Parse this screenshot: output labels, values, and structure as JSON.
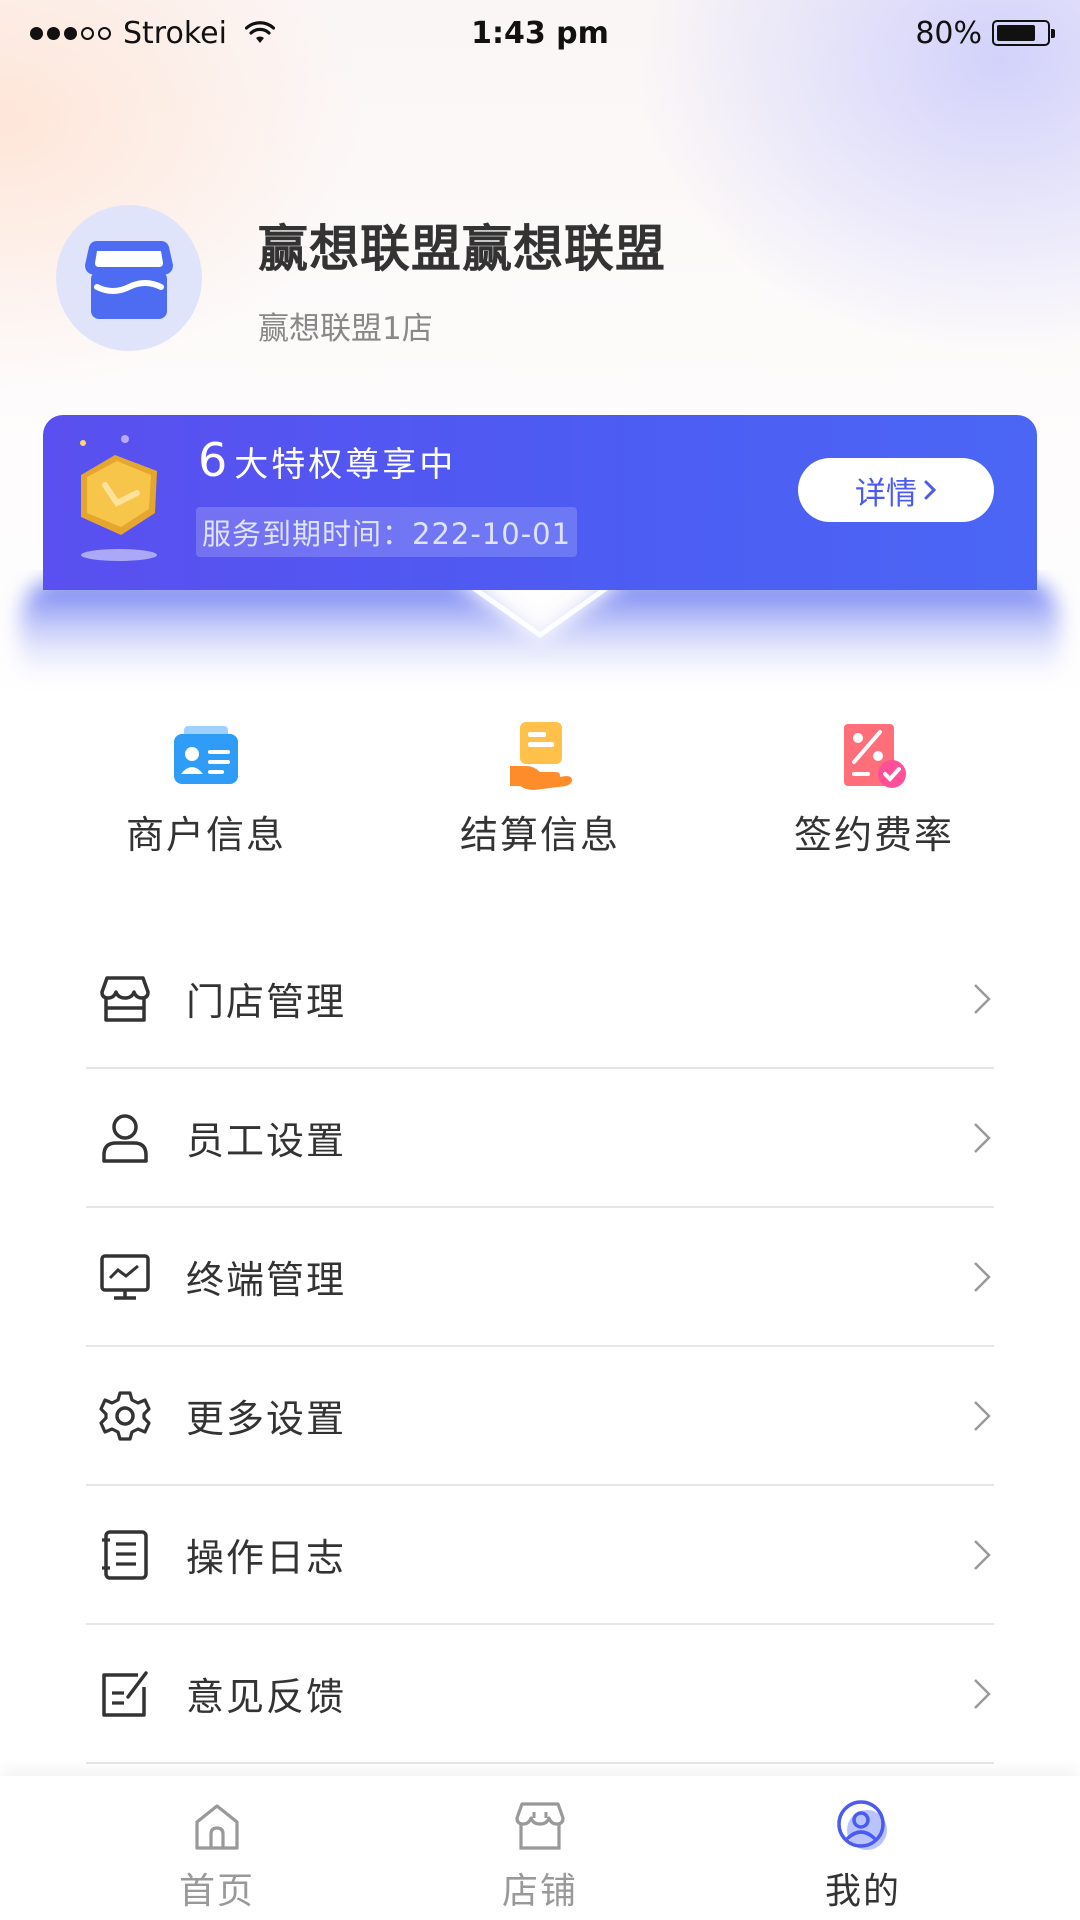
{
  "status_bar": {
    "carrier": "Strokei",
    "time": "1:43 pm",
    "battery": "80%",
    "battery_level": 0.8
  },
  "profile": {
    "store_name": "赢想联盟赢想联盟",
    "branch": "赢想联盟1店"
  },
  "vip": {
    "count": "6",
    "title": "大特权尊享中",
    "expire": "服务到期时间：222-10-01",
    "detail_button": "详情",
    "colors": {
      "start": "#5a4ff0",
      "end": "#4b66f5"
    }
  },
  "quick_actions": [
    {
      "label": "商户信息",
      "icon": "merchant-card-icon"
    },
    {
      "label": "结算信息",
      "icon": "settlement-icon"
    },
    {
      "label": "签约费率",
      "icon": "rate-icon"
    }
  ],
  "menu": [
    {
      "label": "门店管理",
      "icon": "store-icon"
    },
    {
      "label": "员工设置",
      "icon": "user-icon"
    },
    {
      "label": "终端管理",
      "icon": "terminal-icon"
    },
    {
      "label": "更多设置",
      "icon": "gear-icon"
    },
    {
      "label": "操作日志",
      "icon": "log-icon"
    },
    {
      "label": "意见反馈",
      "icon": "feedback-icon"
    }
  ],
  "tabbar": {
    "items": [
      {
        "label": "首页",
        "icon": "home-icon",
        "active": false
      },
      {
        "label": "店铺",
        "icon": "shop-icon",
        "active": false
      },
      {
        "label": "我的",
        "icon": "profile-icon",
        "active": true
      }
    ],
    "active_color": "#4b5bef"
  }
}
